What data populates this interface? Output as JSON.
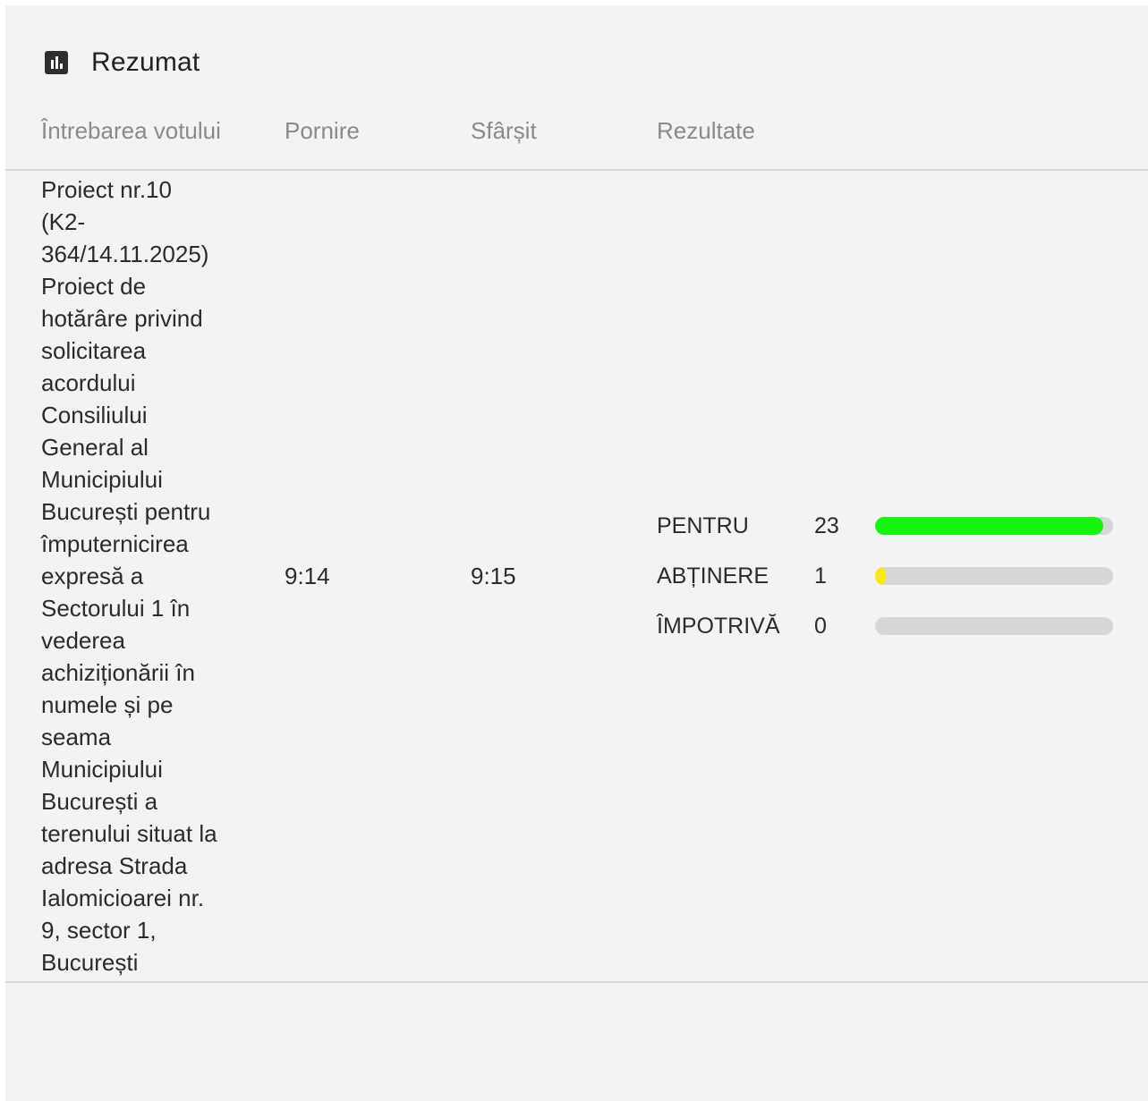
{
  "summary": {
    "title": "Rezumat",
    "icon": "bar-chart-icon"
  },
  "table": {
    "headers": {
      "question": "Întrebarea votului",
      "start": "Pornire",
      "end": "Sfârșit",
      "results": "Rezultate"
    },
    "rows": [
      {
        "question": "Proiect nr.10 (K2-364/14.11.2025) Proiect de hotărâre privind solicitarea acordului Consiliului General al Municipiului București pentru împuternicirea expresă a Sectorului 1 în vederea achiziționării în numele și pe seama Municipiului București a terenului situat la adresa Strada Ialomicioarei nr. 9, sector 1, București",
        "start": "9:14",
        "end": "9:15",
        "results": [
          {
            "label": "PENTRU",
            "count": "23",
            "fraction": 0.958,
            "color": "#15f50f"
          },
          {
            "label": "ABȚINERE",
            "count": "1",
            "fraction": 0.042,
            "color": "#f5ea0a"
          },
          {
            "label": "ÎMPOTRIVĂ",
            "count": "0",
            "fraction": 0,
            "color": "#e0402f"
          }
        ]
      }
    ]
  }
}
